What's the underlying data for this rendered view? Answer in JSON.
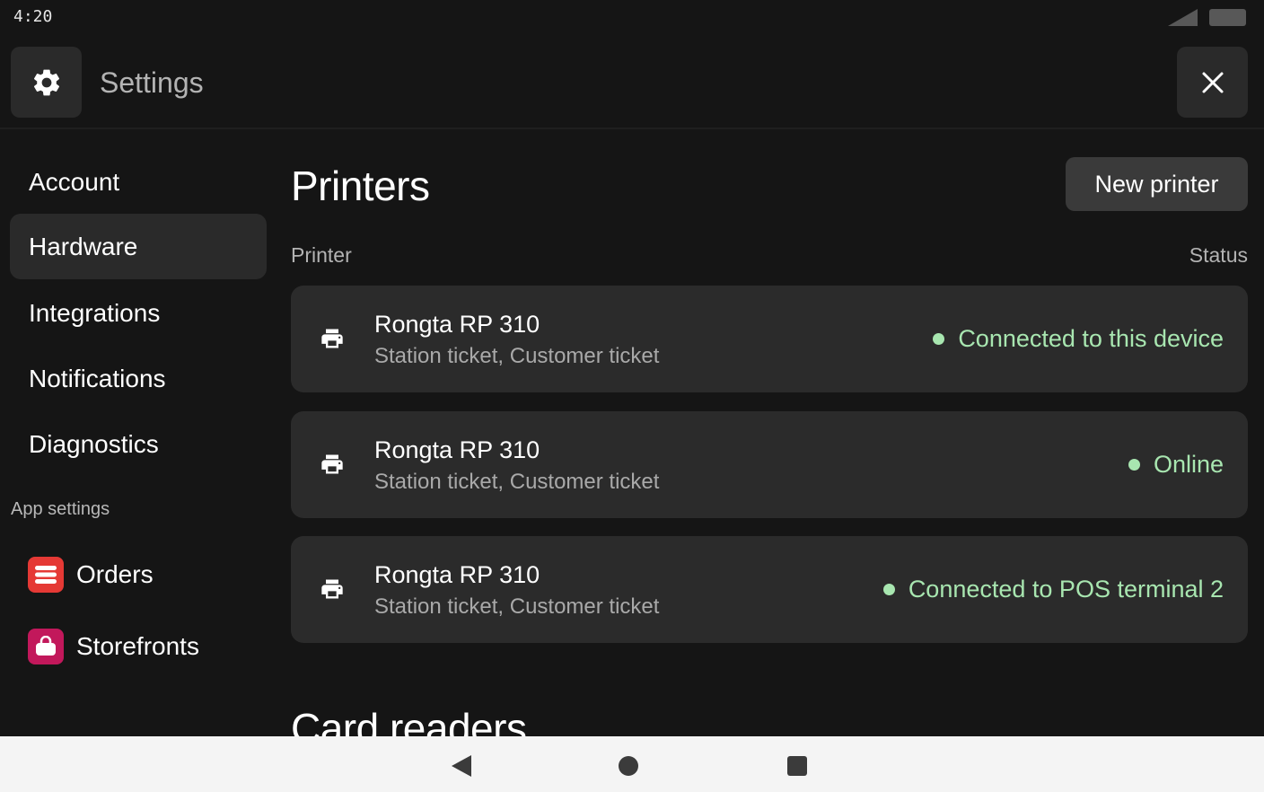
{
  "status_bar": {
    "time": "4:20"
  },
  "header": {
    "title": "Settings",
    "settings_icon": "gear-icon",
    "close_icon": "close-icon"
  },
  "sidebar": {
    "items": [
      {
        "label": "Account",
        "active": false
      },
      {
        "label": "Hardware",
        "active": true
      },
      {
        "label": "Integrations",
        "active": false
      },
      {
        "label": "Notifications",
        "active": false
      },
      {
        "label": "Diagnostics",
        "active": false
      }
    ],
    "section_label": "App settings",
    "apps": [
      {
        "label": "Orders",
        "icon": "orders-list-icon",
        "color": "#e53935"
      },
      {
        "label": "Storefronts",
        "icon": "storefront-bag-icon",
        "color": "#c2185b"
      }
    ]
  },
  "main": {
    "title": "Printers",
    "new_button": "New printer",
    "col_printer": "Printer",
    "col_status": "Status",
    "printers": [
      {
        "name": "Rongta RP 310",
        "tickets": "Station ticket, Customer ticket",
        "status": "Connected to this device"
      },
      {
        "name": "Rongta RP 310",
        "tickets": "Station ticket, Customer ticket",
        "status": "Online"
      },
      {
        "name": "Rongta RP 310",
        "tickets": "Station ticket, Customer ticket",
        "status": "Connected to POS terminal 2"
      }
    ],
    "next_section_title": "Card readers"
  },
  "colors": {
    "status_green": "#a8e6b0",
    "row_bg": "#2b2b2b",
    "bg": "#151515"
  }
}
